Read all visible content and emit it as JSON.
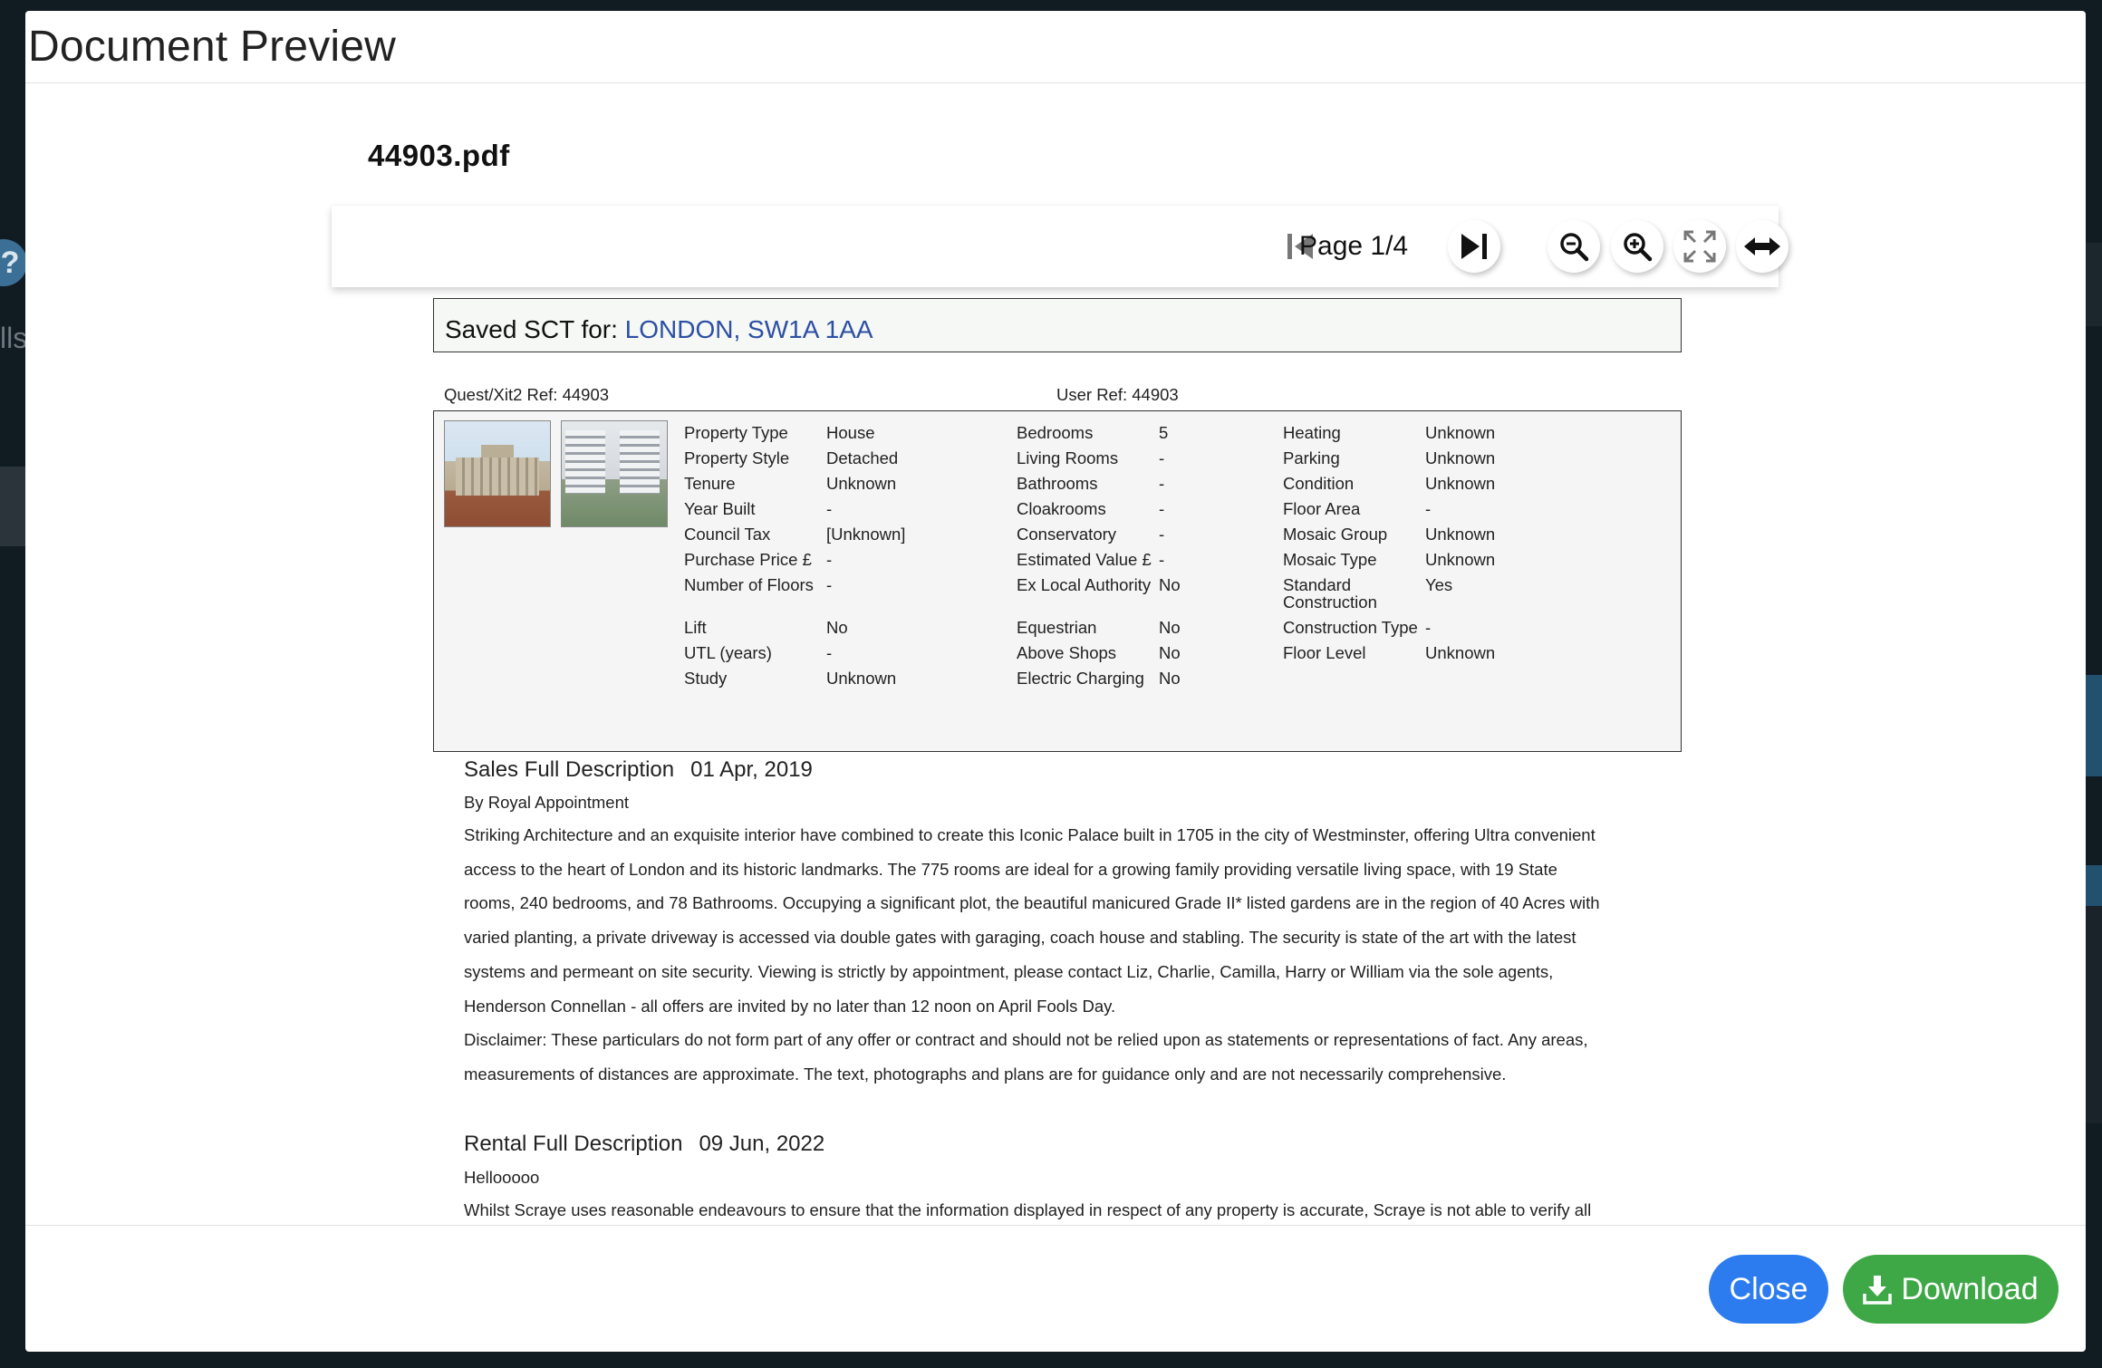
{
  "background": {
    "help_glyph": "?",
    "partial_text": "lls"
  },
  "modal": {
    "title": "Document Preview",
    "file_name": "44903.pdf",
    "toolbar": {
      "page_label": "Page 1/4",
      "icons": [
        "first-page-icon",
        "last-page-icon",
        "zoom-out-icon",
        "zoom-in-icon",
        "fullscreen-icon",
        "fit-width-icon"
      ]
    },
    "footer": {
      "close_label": "Close",
      "download_label": "Download"
    },
    "colors": {
      "close": "#2c7cf0",
      "download": "#3ea846",
      "address_link": "#2d4fa3"
    }
  },
  "document": {
    "saved_label": "Saved SCT for:",
    "address": "LONDON, SW1A 1AA",
    "quest_ref": "Quest/Xit2 Ref: 44903",
    "user_ref": "User Ref: 44903",
    "rows": [
      [
        "Property Type",
        "House",
        "Bedrooms",
        "5",
        "Heating",
        "Unknown"
      ],
      [
        "Property Style",
        "Detached",
        "Living Rooms",
        "-",
        "Parking",
        "Unknown"
      ],
      [
        "Tenure",
        "Unknown",
        "Bathrooms",
        "-",
        "Condition",
        "Unknown"
      ],
      [
        "Year Built",
        "-",
        "Cloakrooms",
        "-",
        "Floor Area",
        "-"
      ],
      [
        "Council Tax",
        "[Unknown]",
        "Conservatory",
        "-",
        "Mosaic Group",
        "Unknown"
      ],
      [
        "Purchase Price £",
        "-",
        "Estimated Value £",
        "-",
        "Mosaic Type",
        "Unknown"
      ],
      [
        "Number of Floors",
        "-",
        "Ex Local Authority",
        "No",
        "Standard Construction",
        "Yes"
      ],
      [
        "Lift",
        "No",
        "Equestrian",
        "No",
        "Construction Type",
        "-"
      ],
      [
        "UTL (years)",
        "-",
        "Above Shops",
        "No",
        "Floor Level",
        "Unknown"
      ],
      [
        "Study",
        "Unknown",
        "Electric Charging",
        "No",
        "",
        ""
      ]
    ],
    "sales": {
      "heading": "Sales Full Description",
      "date": "01 Apr, 2019",
      "subtitle": "By Royal Appointment",
      "lines": [
        "Striking Architecture and an exquisite interior have combined to create this Iconic Palace built in 1705 in the city of Westminster, offering Ultra convenient",
        "access to the heart of London and its historic landmarks.  The 775 rooms are ideal for a growing family providing versatile living space, with 19 State",
        "rooms, 240 bedrooms, and 78 Bathrooms.  Occupying a significant plot, the beautiful manicured Grade II* listed gardens are in the region of 40 Acres with",
        "varied planting, a private driveway is accessed via double gates with garaging, coach house and stabling.  The security is state of the art with the latest",
        "systems and permeant on site security.  Viewing is strictly by appointment, please contact Liz, Charlie, Camilla, Harry or William via the sole agents,",
        "Henderson Connellan - all offers are invited by no later than 12 noon on April Fools Day.",
        "Disclaimer: These particulars do not form part of any offer or contract and should not be relied upon as statements or representations of fact. Any areas,",
        "measurements of distances are approximate. The text, photographs and plans are for guidance only and are not necessarily comprehensive."
      ]
    },
    "rental": {
      "heading": "Rental Full Description",
      "date": "09 Jun, 2022",
      "subtitle": "Hellooooo",
      "lines": [
        "Whilst Scraye uses reasonable endeavours to ensure that the information displayed in respect of any property is accurate, Scraye is not able to verify all"
      ]
    }
  }
}
